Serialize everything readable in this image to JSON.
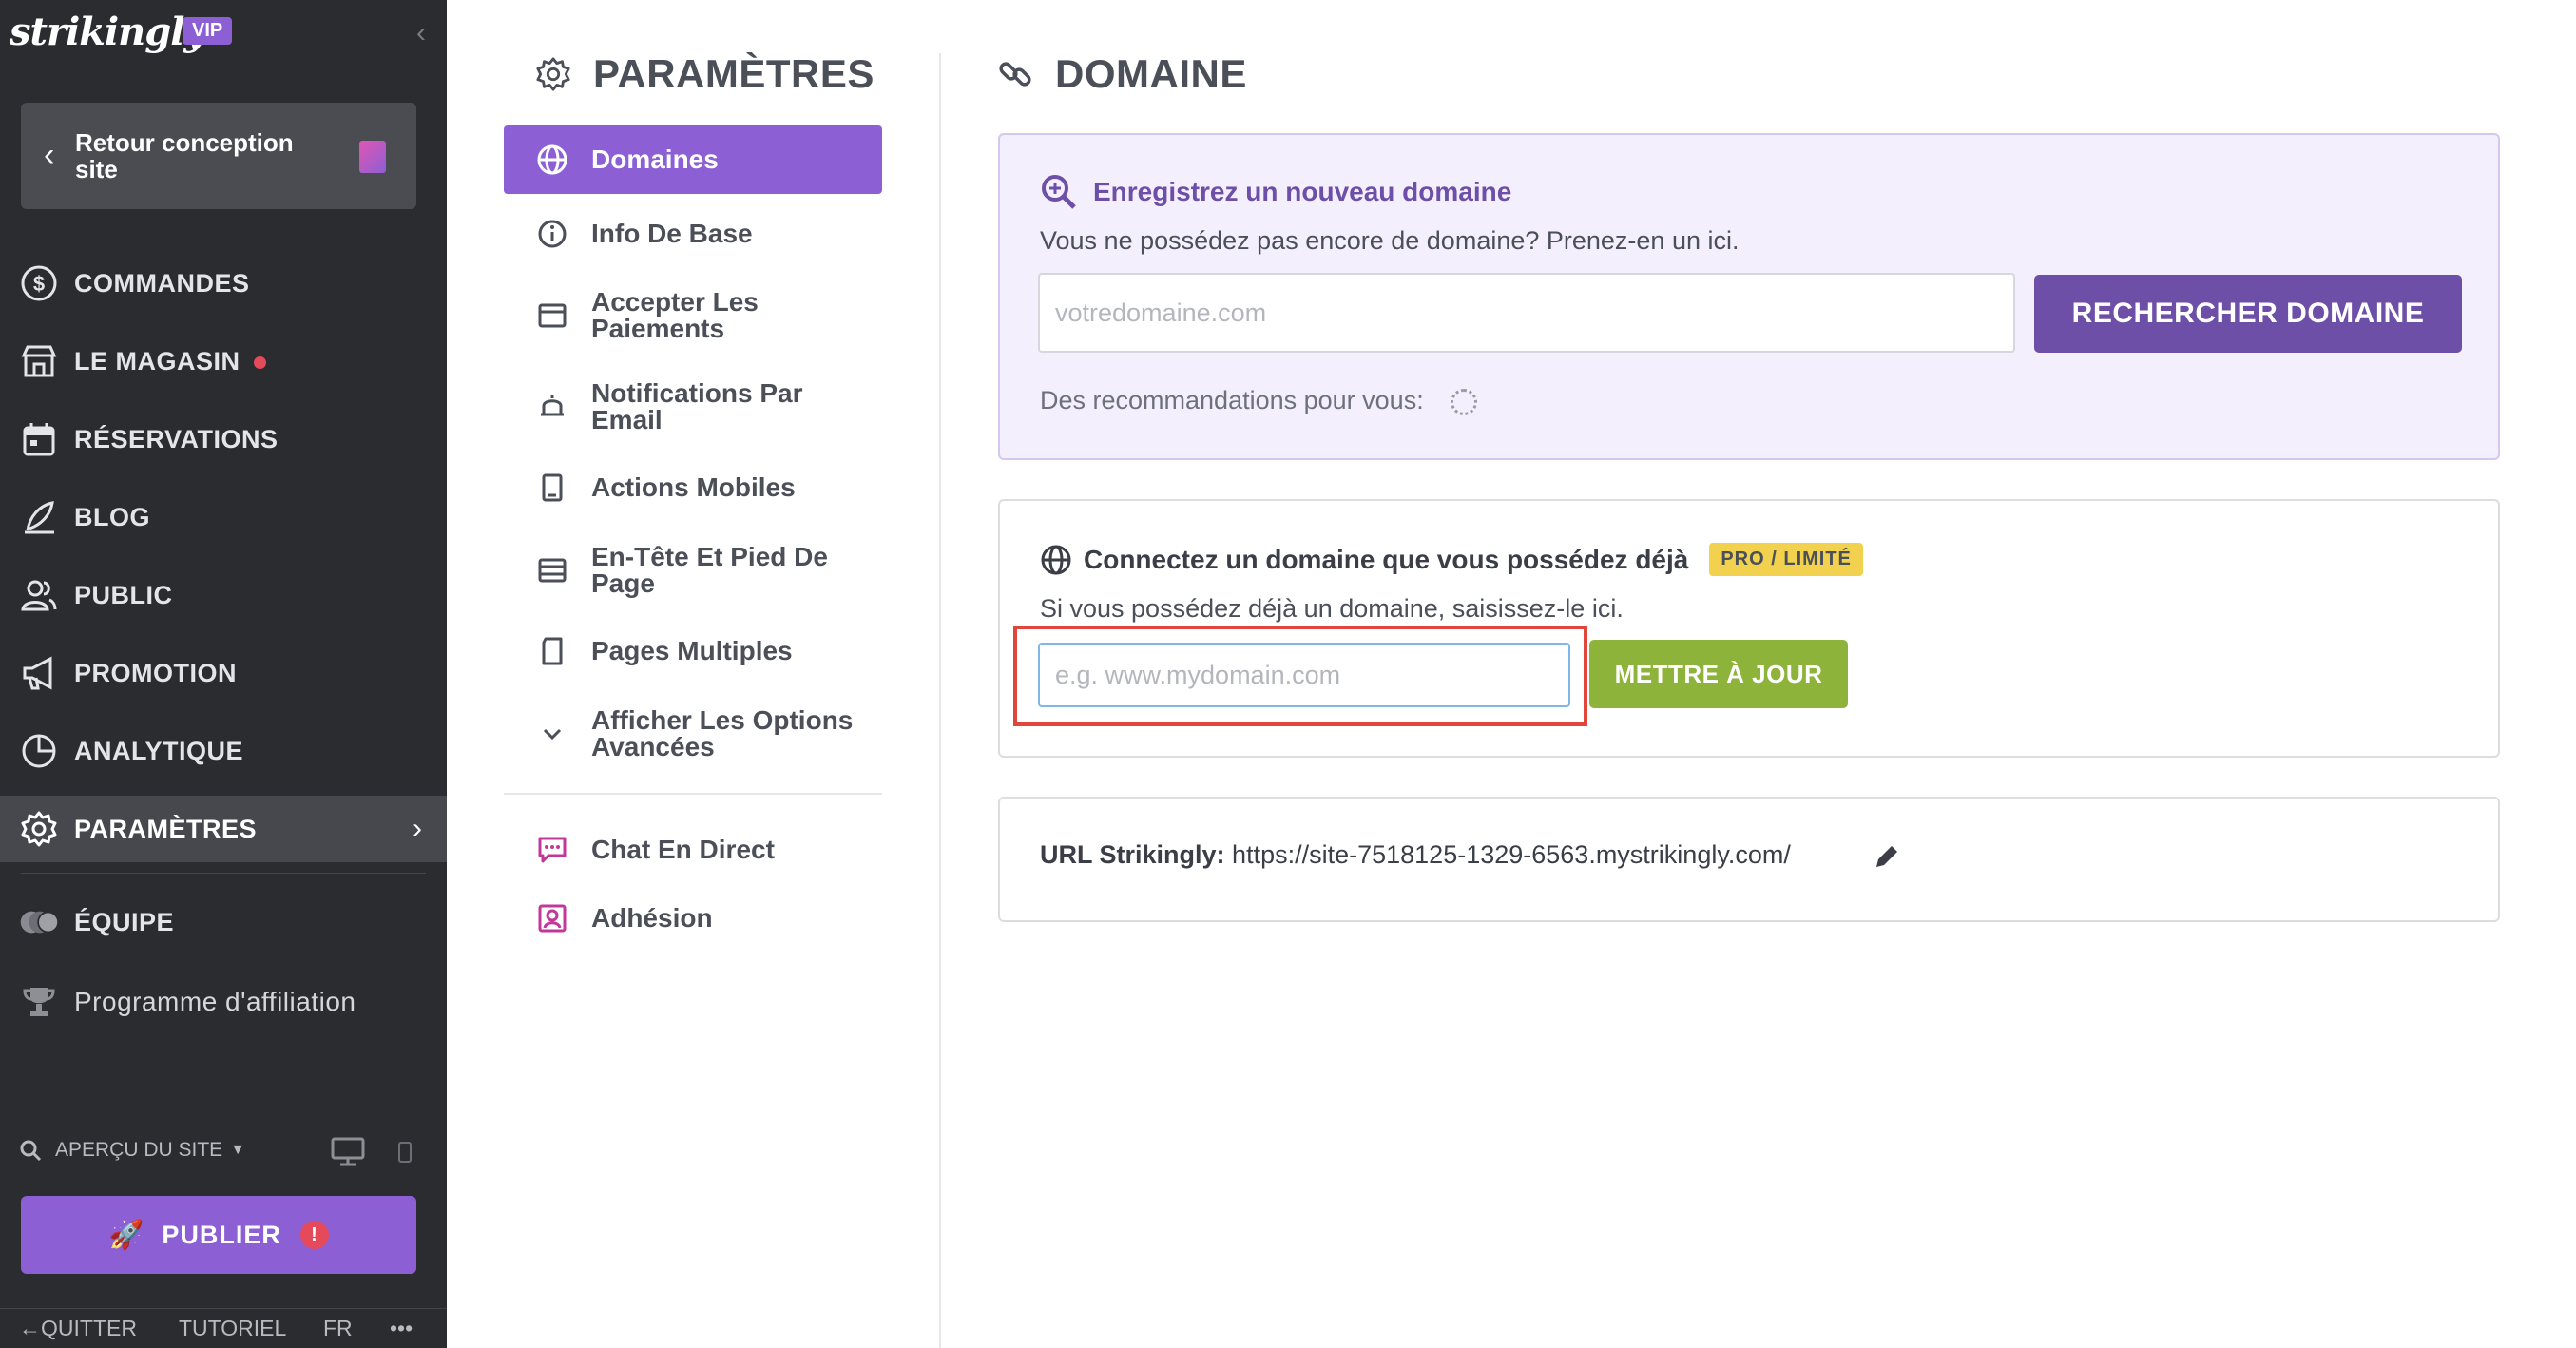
{
  "brand": {
    "logo": "strikingly",
    "badge": "VIP"
  },
  "sidebar": {
    "back": "Retour conception site",
    "items": [
      {
        "label": "COMMANDES",
        "icon": "dollar-circle-icon"
      },
      {
        "label": "LE MAGASIN",
        "icon": "store-icon"
      },
      {
        "label": "RÉSERVATIONS",
        "icon": "calendar-icon"
      },
      {
        "label": "BLOG",
        "icon": "quill-icon"
      },
      {
        "label": "PUBLIC",
        "icon": "users-icon"
      },
      {
        "label": "PROMOTION",
        "icon": "megaphone-icon"
      },
      {
        "label": "ANALYTIQUE",
        "icon": "pie-chart-icon"
      },
      {
        "label": "PARAMÈTRES",
        "icon": "gear-icon"
      },
      {
        "label": "ÉQUIPE",
        "icon": "team-avatars-icon"
      },
      {
        "label": "Programme d'affiliation",
        "icon": "trophy-icon"
      }
    ],
    "preview": "APERÇU DU SITE",
    "publish": "PUBLIER",
    "bottom": {
      "quit": "QUITTER",
      "tutorial": "TUTORIEL",
      "lang": "FR",
      "more": "•••"
    }
  },
  "settings": {
    "title": "PARAMÈTRES",
    "menu": [
      {
        "label": "Domaines",
        "icon": "globe-icon"
      },
      {
        "label": "Info De Base",
        "icon": "info-icon"
      },
      {
        "label": "Accepter Les Paiements",
        "icon": "card-icon"
      },
      {
        "label": "Notifications Par Email",
        "icon": "bell-icon"
      },
      {
        "label": "Actions Mobiles",
        "icon": "mobile-icon"
      },
      {
        "label": "En-Tête Et Pied De Page",
        "icon": "layout-icon"
      },
      {
        "label": "Pages Multiples",
        "icon": "pages-icon"
      },
      {
        "label": "Afficher Les Options Avancées",
        "icon": "chevron-down-icon"
      }
    ],
    "extra": [
      {
        "label": "Chat En Direct",
        "icon": "chat-icon"
      },
      {
        "label": "Adhésion",
        "icon": "member-icon"
      }
    ]
  },
  "domain": {
    "title": "DOMAINE",
    "register": {
      "heading": "Enregistrez un nouveau domaine",
      "text": "Vous ne possédez pas encore de domaine? Prenez-en un ici.",
      "placeholder": "votredomaine.com",
      "button": "RECHERCHER DOMAINE",
      "recommend": "Des recommandations pour vous:"
    },
    "connect": {
      "heading": "Connectez un domaine que vous possédez déjà",
      "badge": "PRO / LIMITÉ",
      "text": "Si vous possédez déjà un domaine, saisissez-le ici.",
      "placeholder": "e.g. www.mydomain.com",
      "button": "METTRE À JOUR"
    },
    "url": {
      "label": "URL Strikingly:",
      "value": "https://site-7518125-1329-6563.mystrikingly.com/"
    }
  },
  "colors": {
    "accent": "#8d5fd5",
    "dark": "#2b2c2f",
    "green": "#8db33a",
    "badge": "#f1d14d",
    "highlight": "#e0463c"
  }
}
